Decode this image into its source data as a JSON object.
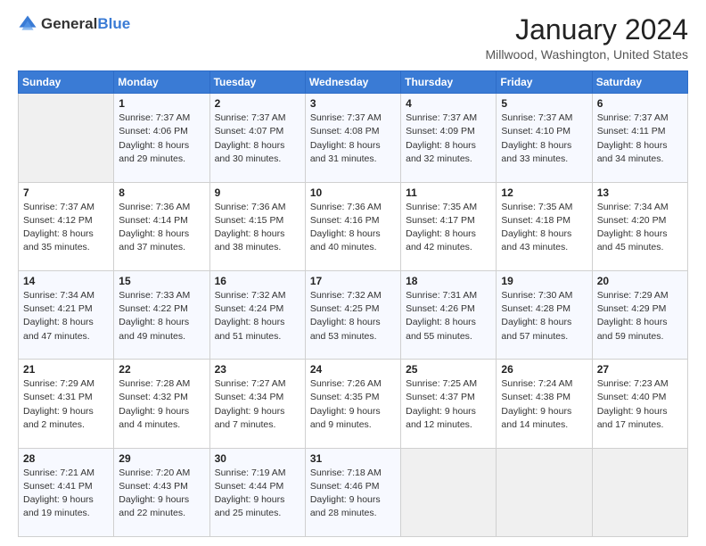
{
  "header": {
    "logo_general": "General",
    "logo_blue": "Blue",
    "month_title": "January 2024",
    "location": "Millwood, Washington, United States"
  },
  "days_of_week": [
    "Sunday",
    "Monday",
    "Tuesday",
    "Wednesday",
    "Thursday",
    "Friday",
    "Saturday"
  ],
  "weeks": [
    [
      {
        "day": "",
        "info": ""
      },
      {
        "day": "1",
        "info": "Sunrise: 7:37 AM\nSunset: 4:06 PM\nDaylight: 8 hours\nand 29 minutes."
      },
      {
        "day": "2",
        "info": "Sunrise: 7:37 AM\nSunset: 4:07 PM\nDaylight: 8 hours\nand 30 minutes."
      },
      {
        "day": "3",
        "info": "Sunrise: 7:37 AM\nSunset: 4:08 PM\nDaylight: 8 hours\nand 31 minutes."
      },
      {
        "day": "4",
        "info": "Sunrise: 7:37 AM\nSunset: 4:09 PM\nDaylight: 8 hours\nand 32 minutes."
      },
      {
        "day": "5",
        "info": "Sunrise: 7:37 AM\nSunset: 4:10 PM\nDaylight: 8 hours\nand 33 minutes."
      },
      {
        "day": "6",
        "info": "Sunrise: 7:37 AM\nSunset: 4:11 PM\nDaylight: 8 hours\nand 34 minutes."
      }
    ],
    [
      {
        "day": "7",
        "info": "Sunrise: 7:37 AM\nSunset: 4:12 PM\nDaylight: 8 hours\nand 35 minutes."
      },
      {
        "day": "8",
        "info": "Sunrise: 7:36 AM\nSunset: 4:14 PM\nDaylight: 8 hours\nand 37 minutes."
      },
      {
        "day": "9",
        "info": "Sunrise: 7:36 AM\nSunset: 4:15 PM\nDaylight: 8 hours\nand 38 minutes."
      },
      {
        "day": "10",
        "info": "Sunrise: 7:36 AM\nSunset: 4:16 PM\nDaylight: 8 hours\nand 40 minutes."
      },
      {
        "day": "11",
        "info": "Sunrise: 7:35 AM\nSunset: 4:17 PM\nDaylight: 8 hours\nand 42 minutes."
      },
      {
        "day": "12",
        "info": "Sunrise: 7:35 AM\nSunset: 4:18 PM\nDaylight: 8 hours\nand 43 minutes."
      },
      {
        "day": "13",
        "info": "Sunrise: 7:34 AM\nSunset: 4:20 PM\nDaylight: 8 hours\nand 45 minutes."
      }
    ],
    [
      {
        "day": "14",
        "info": "Sunrise: 7:34 AM\nSunset: 4:21 PM\nDaylight: 8 hours\nand 47 minutes."
      },
      {
        "day": "15",
        "info": "Sunrise: 7:33 AM\nSunset: 4:22 PM\nDaylight: 8 hours\nand 49 minutes."
      },
      {
        "day": "16",
        "info": "Sunrise: 7:32 AM\nSunset: 4:24 PM\nDaylight: 8 hours\nand 51 minutes."
      },
      {
        "day": "17",
        "info": "Sunrise: 7:32 AM\nSunset: 4:25 PM\nDaylight: 8 hours\nand 53 minutes."
      },
      {
        "day": "18",
        "info": "Sunrise: 7:31 AM\nSunset: 4:26 PM\nDaylight: 8 hours\nand 55 minutes."
      },
      {
        "day": "19",
        "info": "Sunrise: 7:30 AM\nSunset: 4:28 PM\nDaylight: 8 hours\nand 57 minutes."
      },
      {
        "day": "20",
        "info": "Sunrise: 7:29 AM\nSunset: 4:29 PM\nDaylight: 8 hours\nand 59 minutes."
      }
    ],
    [
      {
        "day": "21",
        "info": "Sunrise: 7:29 AM\nSunset: 4:31 PM\nDaylight: 9 hours\nand 2 minutes."
      },
      {
        "day": "22",
        "info": "Sunrise: 7:28 AM\nSunset: 4:32 PM\nDaylight: 9 hours\nand 4 minutes."
      },
      {
        "day": "23",
        "info": "Sunrise: 7:27 AM\nSunset: 4:34 PM\nDaylight: 9 hours\nand 7 minutes."
      },
      {
        "day": "24",
        "info": "Sunrise: 7:26 AM\nSunset: 4:35 PM\nDaylight: 9 hours\nand 9 minutes."
      },
      {
        "day": "25",
        "info": "Sunrise: 7:25 AM\nSunset: 4:37 PM\nDaylight: 9 hours\nand 12 minutes."
      },
      {
        "day": "26",
        "info": "Sunrise: 7:24 AM\nSunset: 4:38 PM\nDaylight: 9 hours\nand 14 minutes."
      },
      {
        "day": "27",
        "info": "Sunrise: 7:23 AM\nSunset: 4:40 PM\nDaylight: 9 hours\nand 17 minutes."
      }
    ],
    [
      {
        "day": "28",
        "info": "Sunrise: 7:21 AM\nSunset: 4:41 PM\nDaylight: 9 hours\nand 19 minutes."
      },
      {
        "day": "29",
        "info": "Sunrise: 7:20 AM\nSunset: 4:43 PM\nDaylight: 9 hours\nand 22 minutes."
      },
      {
        "day": "30",
        "info": "Sunrise: 7:19 AM\nSunset: 4:44 PM\nDaylight: 9 hours\nand 25 minutes."
      },
      {
        "day": "31",
        "info": "Sunrise: 7:18 AM\nSunset: 4:46 PM\nDaylight: 9 hours\nand 28 minutes."
      },
      {
        "day": "",
        "info": ""
      },
      {
        "day": "",
        "info": ""
      },
      {
        "day": "",
        "info": ""
      }
    ]
  ]
}
